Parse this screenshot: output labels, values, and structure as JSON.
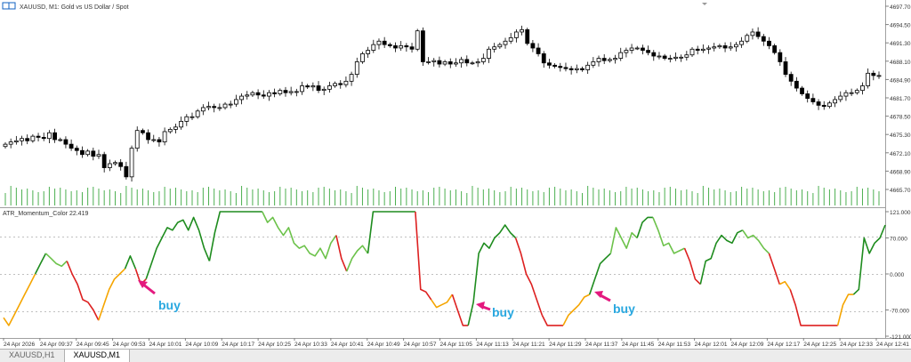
{
  "window": {
    "title": "XAUUSD, M1:  Gold vs US Dollar / Spot"
  },
  "indicator": {
    "label": "ATR_Momentum_Color 22.419"
  },
  "tabs": [
    {
      "label": "XAUUSD,H1",
      "active": false
    },
    {
      "label": "XAUUSD,M1",
      "active": true
    }
  ],
  "annotations": [
    {
      "text": "buy",
      "color": "#29a8e0",
      "arrow_color": "#e4197f"
    },
    {
      "text": "buy",
      "color": "#29a8e0",
      "arrow_color": "#e4197f"
    },
    {
      "text": "buy",
      "color": "#29a8e0",
      "arrow_color": "#e4197f"
    }
  ],
  "colors": {
    "bull_candle": "#ffffff",
    "bear_candle": "#000000",
    "volume": "#4caf50",
    "ind_green_dark": "#1e8c1e",
    "ind_green_light": "#6cc24a",
    "ind_red": "#dd2020",
    "ind_orange": "#f5a500"
  },
  "chart_data": [
    {
      "type": "candlestick",
      "symbol": "XAUUSD",
      "timeframe": "M1",
      "y_ticks": [
        "4697.70",
        "4694.50",
        "4691.30",
        "4688.10",
        "4684.90",
        "4681.70",
        "4678.50",
        "4675.30",
        "4672.10",
        "4668.90",
        "4665.70"
      ],
      "ylim": [
        4665.0,
        4698.0
      ],
      "close_path": [
        4673.6,
        4674.0,
        4674.2,
        4674.6,
        4674.2,
        4675.0,
        4674.8,
        4674.6,
        4675.6,
        4674.4,
        4674.4,
        4673.6,
        4672.9,
        4672.5,
        4671.8,
        4672.4,
        4671.5,
        4671.8,
        4669.5,
        4670.2,
        4670.4,
        4669.7,
        4667.9,
        4672.9,
        4676.0,
        4675.6,
        4674.4,
        4674.4,
        4674.0,
        4675.8,
        4676.2,
        4676.6,
        4677.6,
        4678.4,
        4678.4,
        4679.4,
        4680.0,
        4680.2,
        4680.0,
        4680.0,
        4680.6,
        4680.6,
        4681.4,
        4682.0,
        4682.2,
        4682.6,
        4682.2,
        4682.0,
        4682.6,
        4682.4,
        4683.0,
        4682.6,
        4682.8,
        4682.8,
        4683.8,
        4683.6,
        4683.8,
        4683.0,
        4683.2,
        4683.8,
        4684.2,
        4684.0,
        4684.6,
        4685.8,
        4688.0,
        4689.4,
        4690.0,
        4691.0,
        4691.6,
        4691.0,
        4690.8,
        4690.4,
        4690.8,
        4690.6,
        4690.2,
        4693.4,
        4688.0,
        4688.0,
        4688.2,
        4687.6,
        4688.0,
        4687.6,
        4687.8,
        4688.4,
        4687.8,
        4687.8,
        4688.0,
        4688.6,
        4690.2,
        4690.6,
        4691.0,
        4691.6,
        4692.2,
        4693.2,
        4693.6,
        4691.2,
        4690.4,
        4689.4,
        4687.8,
        4687.4,
        4687.2,
        4687.0,
        4686.8,
        4686.6,
        4686.8,
        4686.6,
        4687.4,
        4688.0,
        4688.6,
        4688.2,
        4688.4,
        4688.6,
        4689.6,
        4690.0,
        4690.4,
        4690.4,
        4690.0,
        4689.6,
        4689.0,
        4689.0,
        4688.6,
        4688.6,
        4688.8,
        4688.8,
        4689.2,
        4690.2,
        4690.0,
        4690.2,
        4690.4,
        4690.6,
        4690.8,
        4690.4,
        4690.6,
        4691.0,
        4691.6,
        4692.6,
        4693.2,
        4692.4,
        4691.6,
        4690.8,
        4689.6,
        4688.0,
        4685.8,
        4684.6,
        4683.4,
        4682.4,
        4681.6,
        4681.0,
        4680.4,
        4680.2,
        4680.8,
        4681.4,
        4682.0,
        4682.6,
        4682.6,
        4683.0,
        4683.8,
        4686.0,
        4685.6,
        4685.6
      ]
    },
    {
      "type": "bar",
      "name": "volume",
      "y_tick": "4665.70"
    },
    {
      "type": "line",
      "name": "ATR_Momentum_Color",
      "value_label": "22.419",
      "y_ticks": [
        "121.000",
        "70.000",
        "0.000",
        "-70.000",
        "-121.000"
      ],
      "ylim": [
        -121,
        121
      ],
      "x_labels": [
        "24 Apr 2026",
        "24 Apr 09:37",
        "24 Apr 09:45",
        "24 Apr 09:53",
        "24 Apr 10:01",
        "24 Apr 10:09",
        "24 Apr 10:17",
        "24 Apr 10:25",
        "24 Apr 10:33",
        "24 Apr 10:41",
        "24 Apr 10:49",
        "24 Apr 10:57",
        "24 Apr 11:05",
        "24 Apr 11:13",
        "24 Apr 11:21",
        "24 Apr 11:29",
        "24 Apr 11:37",
        "24 Apr 11:45",
        "24 Apr 11:53",
        "24 Apr 12:01",
        "24 Apr 12:09",
        "24 Apr 12:17",
        "24 Apr 12:25",
        "24 Apr 12:33",
        "24 Apr 12:41"
      ],
      "segments": [
        {
          "color": "orange",
          "values": [
            -85,
            -100,
            -80,
            -60,
            -40,
            -20,
            0
          ]
        },
        {
          "color": "green_dark",
          "values": [
            0,
            20,
            40
          ]
        },
        {
          "color": "green_light",
          "values": [
            40,
            30,
            20,
            15,
            25
          ]
        },
        {
          "color": "red",
          "values": [
            25,
            0,
            -20,
            -50,
            -55,
            -70,
            -90
          ]
        },
        {
          "color": "orange",
          "values": [
            -90,
            -60,
            -30,
            -10,
            0,
            10
          ]
        },
        {
          "color": "green_dark",
          "values": [
            10,
            35,
            10
          ]
        },
        {
          "color": "red",
          "values": [
            10,
            -20,
            -10
          ]
        },
        {
          "color": "green_dark",
          "values": [
            -10,
            20,
            50,
            70,
            90,
            85,
            100,
            105,
            85,
            110,
            85,
            50,
            25
          ]
        },
        {
          "color": "green_dark",
          "values": [
            25,
            80,
            121,
            121,
            121,
            121,
            121,
            121,
            121,
            121,
            121
          ]
        },
        {
          "color": "green_light",
          "values": [
            121,
            100,
            110,
            90,
            75,
            90,
            60,
            50,
            55,
            40,
            35,
            50,
            30,
            60,
            75
          ]
        },
        {
          "color": "red",
          "values": [
            75,
            30,
            5
          ]
        },
        {
          "color": "green_light",
          "values": [
            5,
            30,
            45,
            55,
            40
          ]
        },
        {
          "color": "green_dark",
          "values": [
            40,
            121,
            121,
            121,
            121,
            121,
            121,
            121,
            121,
            121
          ]
        },
        {
          "color": "red",
          "values": [
            121,
            -30,
            -35,
            -50
          ]
        },
        {
          "color": "orange",
          "values": [
            -50,
            -65,
            -60,
            -55,
            -40
          ]
        },
        {
          "color": "red",
          "values": [
            -40,
            -70,
            -100,
            -100
          ]
        },
        {
          "color": "green_dark",
          "values": [
            -100,
            -55,
            40,
            60,
            50,
            70,
            80,
            95,
            80,
            70
          ]
        },
        {
          "color": "red",
          "values": [
            70,
            40,
            0,
            -20,
            -50,
            -80
          ]
        },
        {
          "color": "red",
          "values": [
            -80,
            -100,
            -100,
            -100,
            -100
          ]
        },
        {
          "color": "orange",
          "values": [
            -100,
            -80,
            -70,
            -60,
            -45,
            -40
          ]
        },
        {
          "color": "green_dark",
          "values": [
            -40,
            -10,
            20,
            30,
            40
          ]
        },
        {
          "color": "green_light",
          "values": [
            40,
            90,
            70,
            50,
            80,
            70
          ]
        },
        {
          "color": "green_dark",
          "values": [
            70,
            100,
            110,
            110
          ]
        },
        {
          "color": "green_light",
          "values": [
            110,
            85,
            55,
            60,
            40,
            45,
            50
          ]
        },
        {
          "color": "red",
          "values": [
            50,
            25,
            -10,
            -20
          ]
        },
        {
          "color": "green_dark",
          "values": [
            -20,
            25,
            30,
            60,
            75,
            65,
            60,
            80,
            85
          ]
        },
        {
          "color": "green_light",
          "values": [
            85,
            70,
            75,
            65,
            50,
            40
          ]
        },
        {
          "color": "red",
          "values": [
            40,
            10,
            -20
          ]
        },
        {
          "color": "orange",
          "values": [
            -20,
            -15,
            -30
          ]
        },
        {
          "color": "red",
          "values": [
            -30,
            -60,
            -100,
            -100,
            -100,
            -100,
            -100,
            -100,
            -100,
            -100
          ]
        },
        {
          "color": "orange",
          "values": [
            -100,
            -60,
            -40,
            -40
          ]
        },
        {
          "color": "green_dark",
          "values": [
            -40,
            -30,
            70,
            40,
            60,
            70,
            95
          ]
        }
      ]
    }
  ]
}
